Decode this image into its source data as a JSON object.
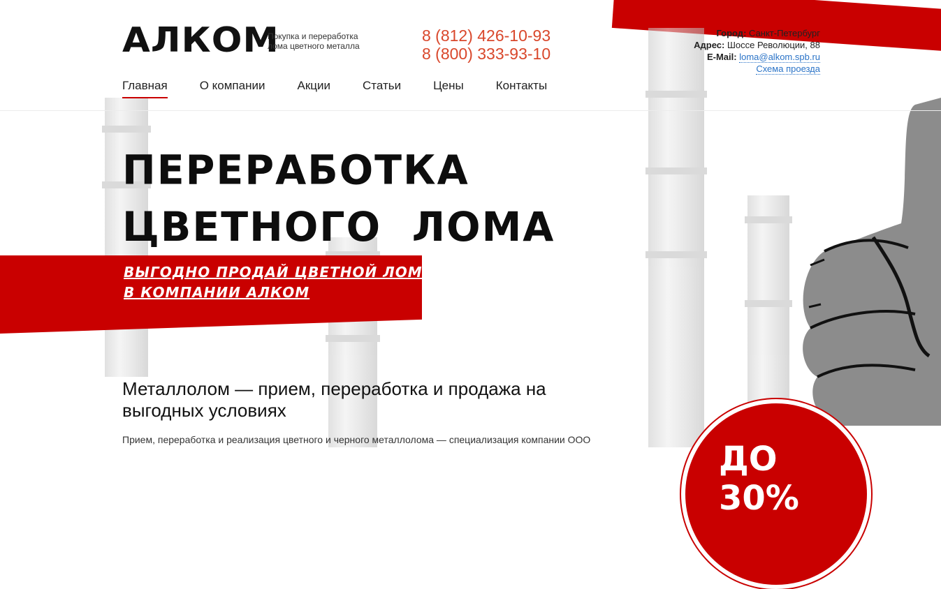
{
  "header": {
    "logo": "АЛКОМ",
    "tagline": [
      "Покупка и переработка",
      "лома цветного металла"
    ],
    "phones": [
      "8 (812) 426-10-93",
      "8 (800) 333-93-10"
    ],
    "contact": {
      "city_label": "Город:",
      "city": "Санкт-Петербург",
      "address_label": "Адрес:",
      "address": "Шоссе Революции, 88",
      "email_label": "E-Mail:",
      "email": "loma@alkom.spb.ru",
      "map_link": "Схема проезда"
    }
  },
  "nav": {
    "items": [
      "Главная",
      "О компании",
      "Акции",
      "Статьи",
      "Цены",
      "Контакты"
    ],
    "active_index": 0
  },
  "hero": {
    "title_lines": [
      "ПЕРЕРАБОТКА",
      "ЦВЕТНОГО  ЛОМА"
    ],
    "subtitle_lines": [
      "ВЫГОДНО ПРОДАЙ ЦВЕТНОЙ ЛОМ",
      "В КОМПАНИИ АЛКОМ"
    ]
  },
  "promo_badge": "ДО 30%",
  "section": {
    "title_lines": [
      "Металлолом — прием, переработка и продажа на",
      "выгодных условиях"
    ],
    "text": "Прием, переработка и реализация цветного и черного металлолома — специализация компании ООО"
  },
  "colors": {
    "accent_red": "#c90000",
    "phone_red": "#d9472b",
    "link_blue": "#2a73c7"
  }
}
